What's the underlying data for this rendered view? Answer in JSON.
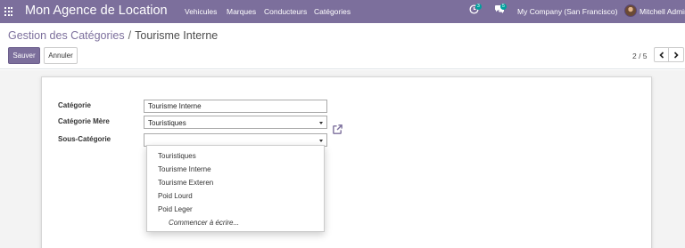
{
  "navbar": {
    "brand": "Mon Agence de Location",
    "menu": [
      "Vehicules",
      "Marques",
      "Conducteurs",
      "Catégories"
    ],
    "activity_count": "3",
    "messages_count": "5",
    "company": "My Company (San Francisco)",
    "user": "Mitchell Admin",
    "icons": [
      "apps-grid-icon",
      "clock-icon",
      "chat-icon",
      "avatar"
    ]
  },
  "breadcrumb": {
    "parent": "Gestion des Catégories",
    "separator": "/",
    "current": "Tourisme Interne"
  },
  "buttons": {
    "save": "Sauver",
    "cancel": "Annuler"
  },
  "pager": {
    "value": "2 / 5",
    "prev_icon": "chevron-left-icon",
    "next_icon": "chevron-right-icon"
  },
  "form": {
    "categorie_label": "Catégorie",
    "categorie_value": "Tourisme Interne",
    "categorie_mere_label": "Catégorie Mère",
    "categorie_mere_value": "Touristiques",
    "sous_categorie_label": "Sous-Catégorie",
    "sous_categorie_value": ""
  },
  "dropdown": {
    "options": [
      "Touristiques",
      "Tourisme Interne",
      "Tourisme Exteren",
      "Poid Lourd",
      "Poid Leger"
    ],
    "hint": "Commencer à écrire..."
  },
  "colors": {
    "navbar": "#7c6f9c",
    "primary": "#7c6f9c",
    "badge": "#00a09d",
    "background": "#f3f3f3"
  }
}
